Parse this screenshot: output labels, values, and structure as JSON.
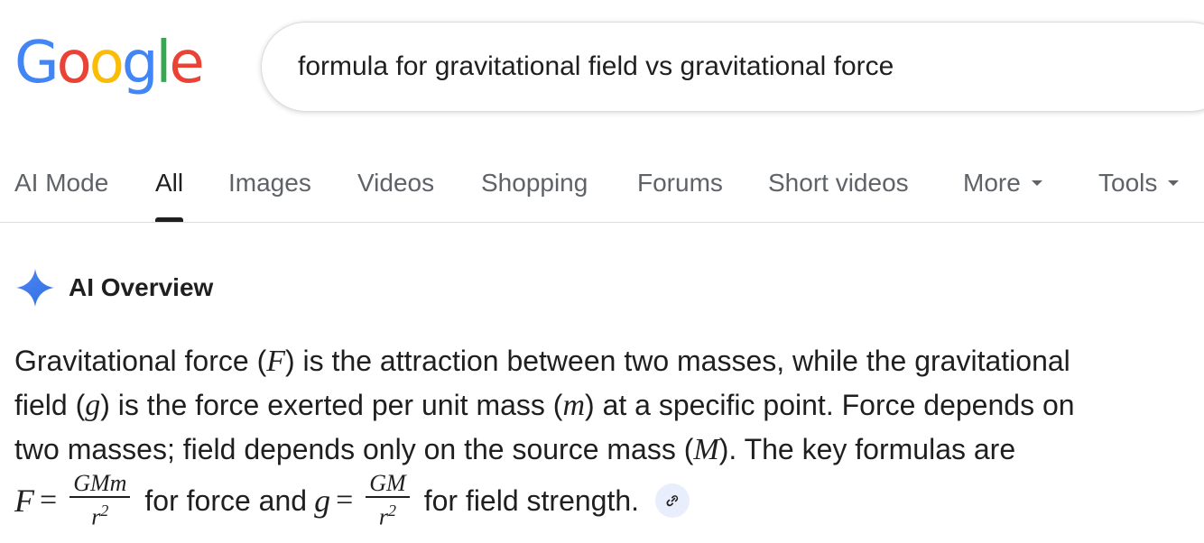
{
  "logo": {
    "letters": [
      "G",
      "o",
      "o",
      "g",
      "l",
      "e"
    ],
    "colors": [
      "#4285F4",
      "#EA4335",
      "#FBBC05",
      "#4285F4",
      "#34A853",
      "#EA4335"
    ]
  },
  "search": {
    "query": "formula for gravitational field vs gravitational force"
  },
  "tabs": [
    {
      "label": "AI Mode"
    },
    {
      "label": "All"
    },
    {
      "label": "Images"
    },
    {
      "label": "Videos"
    },
    {
      "label": "Shopping"
    },
    {
      "label": "Forums"
    },
    {
      "label": "Short videos"
    },
    {
      "label": "More"
    },
    {
      "label": "Tools"
    }
  ],
  "active_tab": "All",
  "ai_overview": {
    "title": "AI Overview",
    "line1_a": "Gravitational force (",
    "var_F": "F",
    "line1_b": ") is the attraction between two masses, while the gravitational field (",
    "var_g": "g",
    "line1_c": ") is the force exerted per unit mass (",
    "var_m": "m",
    "line1_d": ") at a specific point. Force depends on two masses; field depends only on the source mass (",
    "var_M": "M",
    "line1_e": "). The key formulas are",
    "formula_force_lhs": "F",
    "formula_force_num": "GMm",
    "formula_force_den": "r",
    "formula_force_den_exp": "2",
    "for_force": "for force and",
    "formula_field_lhs": "g",
    "formula_field_num": "GM",
    "formula_field_den": "r",
    "formula_field_den_exp": "2",
    "for_field": "for field strength.",
    "equals": "="
  },
  "colors": {
    "accent": "#4285F4",
    "text": "#1f1f1f",
    "muted": "#5f6368",
    "chip": "#e8eefb"
  },
  "icons": {
    "sparkle": "sparkle-icon",
    "link": "link-icon",
    "caret": "caret-down-icon"
  }
}
